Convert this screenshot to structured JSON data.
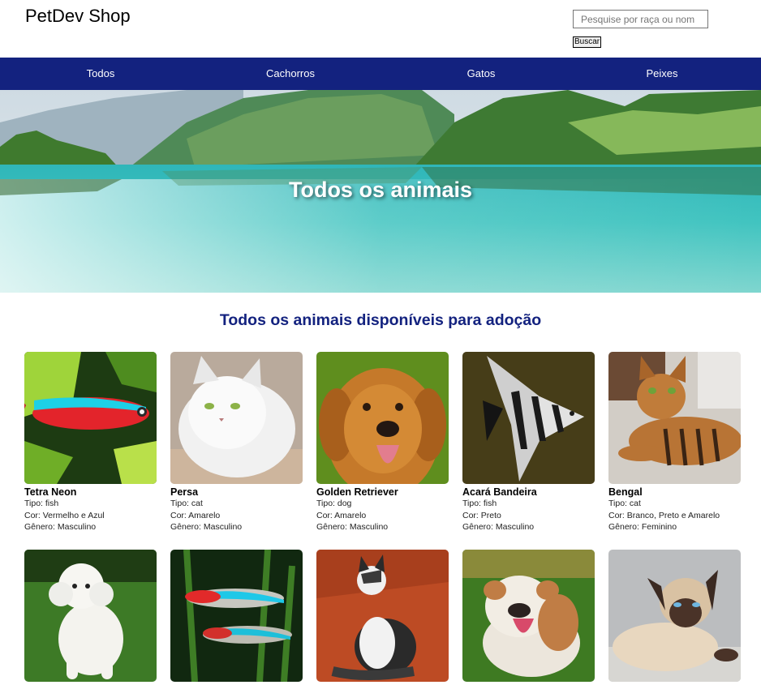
{
  "header": {
    "brand": "PetDev Shop",
    "search_placeholder": "Pesquise por raça ou nom",
    "search_button": "Buscar"
  },
  "nav": {
    "items": [
      "Todos",
      "Cachorros",
      "Gatos",
      "Peixes"
    ]
  },
  "hero": {
    "title": "Todos os animais"
  },
  "section": {
    "title": "Todos os animais disponíveis para adoção"
  },
  "pets": [
    {
      "name": "Tetra Neon",
      "tipo": "Tipo: fish",
      "cor": "Cor: Vermelho e Azul",
      "genero": "Gênero: Masculino"
    },
    {
      "name": "Persa",
      "tipo": "Tipo: cat",
      "cor": "Cor: Amarelo",
      "genero": "Gênero: Masculino"
    },
    {
      "name": "Golden Retriever",
      "tipo": "Tipo: dog",
      "cor": "Cor: Amarelo",
      "genero": "Gênero: Masculino"
    },
    {
      "name": "Acará Bandeira",
      "tipo": "Tipo: fish",
      "cor": "Cor: Preto",
      "genero": "Gênero: Masculino"
    },
    {
      "name": "Bengal",
      "tipo": "Tipo: cat",
      "cor": "Cor: Branco, Preto e Amarelo",
      "genero": "Gênero: Feminino"
    },
    {
      "name": "",
      "tipo": "",
      "cor": "",
      "genero": ""
    },
    {
      "name": "",
      "tipo": "",
      "cor": "",
      "genero": ""
    },
    {
      "name": "",
      "tipo": "",
      "cor": "",
      "genero": ""
    },
    {
      "name": "",
      "tipo": "",
      "cor": "",
      "genero": ""
    },
    {
      "name": "",
      "tipo": "",
      "cor": "",
      "genero": ""
    }
  ],
  "colors": {
    "nav_background": "#13227f",
    "section_title": "#13227f"
  }
}
